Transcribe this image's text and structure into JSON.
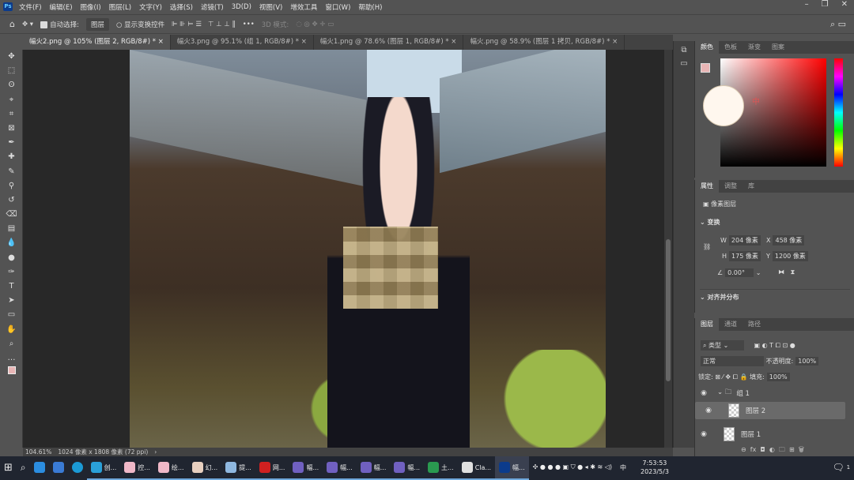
{
  "menubar": {
    "logo": "Ps",
    "items": [
      "文件(F)",
      "编辑(E)",
      "图像(I)",
      "图层(L)",
      "文字(Y)",
      "选择(S)",
      "滤镜(T)",
      "3D(D)",
      "视图(V)",
      "增效工具",
      "窗口(W)",
      "帮助(H)"
    ]
  },
  "options": {
    "auto_select": "自动选择:",
    "auto_select_target": "图层",
    "show_transform": "显示变换控件",
    "mode_3d": "3D 模式:",
    "more": "•••"
  },
  "tabs": [
    "幅火2.png @ 105% (图层 2, RGB/8#) *",
    "幅火3.png @ 95.1% (组 1, RGB/8#) *",
    "幅火1.png @ 78.6% (图层 1, RGB/8#) *",
    "幅火.png @ 58.9% (图层 1 拷贝, RGB/8#) *"
  ],
  "tools": [
    "move",
    "marquee",
    "lasso",
    "quick-select",
    "crop",
    "frame",
    "eyedropper",
    "healing",
    "brush",
    "stamp",
    "history-brush",
    "eraser",
    "gradient",
    "blur",
    "dodge",
    "pen",
    "type",
    "path-select",
    "rectangle",
    "hand",
    "zoom",
    "more"
  ],
  "color_panel": {
    "tabs": [
      "颜色",
      "色板",
      "渐变",
      "图案"
    ],
    "fg_color": "#e8b5b5",
    "bg_color": "#ffffff",
    "ime_label": "中"
  },
  "properties": {
    "tabs": [
      "属性",
      "调整",
      "库"
    ],
    "layer_type": "像素图层",
    "transform_title": "变换",
    "w_label": "W",
    "w": "204 像素",
    "h_label": "H",
    "h": "175 像素",
    "x_label": "X",
    "x": "458 像素",
    "y_label": "Y",
    "y": "1200 像素",
    "angle": "0.00°",
    "align_title": "对齐并分布"
  },
  "layers": {
    "tabs": [
      "图层",
      "通道",
      "路径"
    ],
    "filter": "类型",
    "blend": "正常",
    "opacity_label": "不透明度:",
    "opacity": "100%",
    "lock_label": "锁定:",
    "fill_label": "填充:",
    "fill": "100%",
    "items": [
      {
        "name": "组 1",
        "type": "group"
      },
      {
        "name": "图层 2",
        "selected": true
      },
      {
        "name": "图层 1"
      }
    ]
  },
  "status": {
    "zoom": "104.61%",
    "doc": "1024 像素 x 1808 像素 (72 ppi)"
  },
  "taskbar": {
    "apps": [
      "创...",
      "控...",
      "绘...",
      "幻...",
      "提...",
      "网...",
      "幅...",
      "幅...",
      "幅...",
      "幅...",
      "土...",
      "Cla...",
      "幅..."
    ],
    "ime": "中",
    "time": "7:53:53",
    "date": "2023/5/3",
    "notif": "1"
  }
}
